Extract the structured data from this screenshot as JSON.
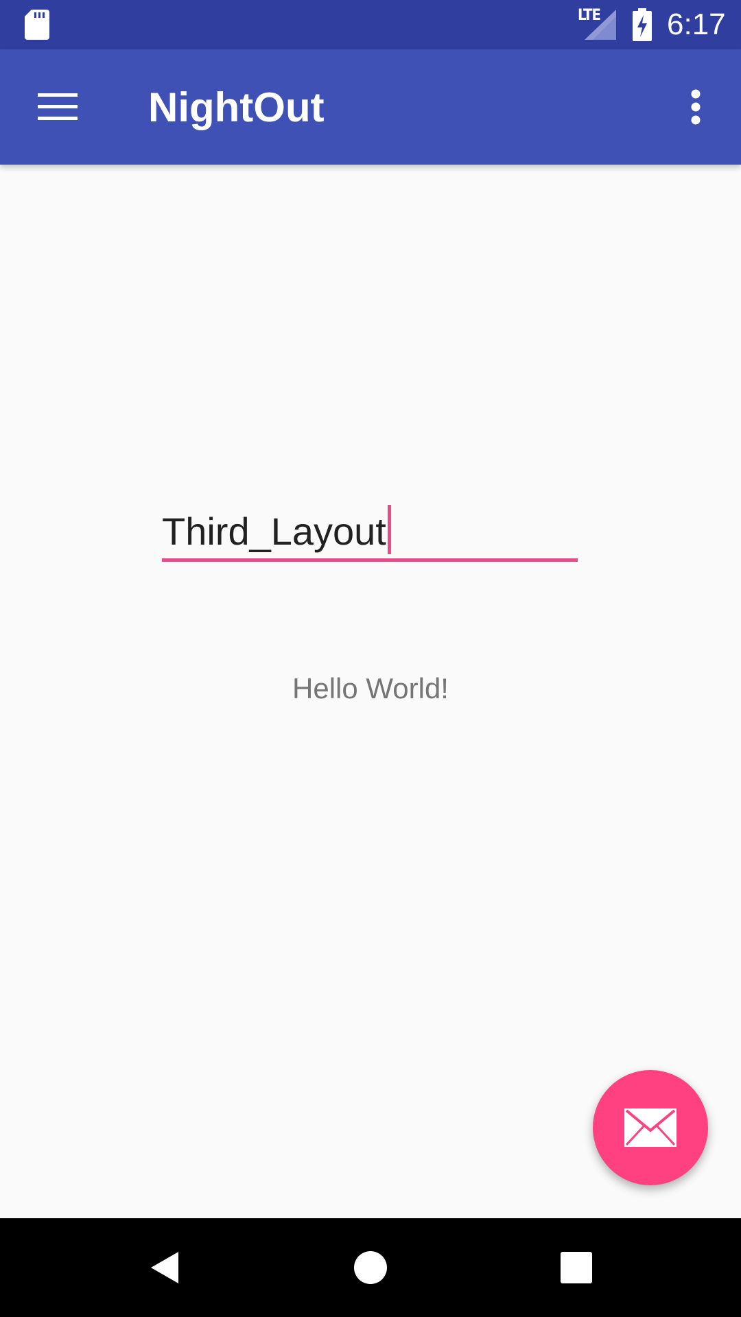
{
  "status_bar": {
    "network": "LTE",
    "time": "6:17",
    "icons": [
      "sd-card-icon",
      "signal-icon",
      "battery-charging-icon"
    ]
  },
  "app_bar": {
    "title": "NightOut",
    "icons": [
      "menu-icon",
      "overflow-menu-icon"
    ]
  },
  "main": {
    "input_value": "Third_Layout",
    "message": "Hello World!"
  },
  "fab": {
    "icon": "mail-icon"
  },
  "nav_bar": {
    "icons": [
      "back-icon",
      "home-icon",
      "recents-icon"
    ]
  },
  "colors": {
    "status_bar": "#303f9f",
    "primary": "#3f51b5",
    "accent": "#ff4081",
    "input_accent": "#e84a88",
    "background": "#fafafa"
  }
}
